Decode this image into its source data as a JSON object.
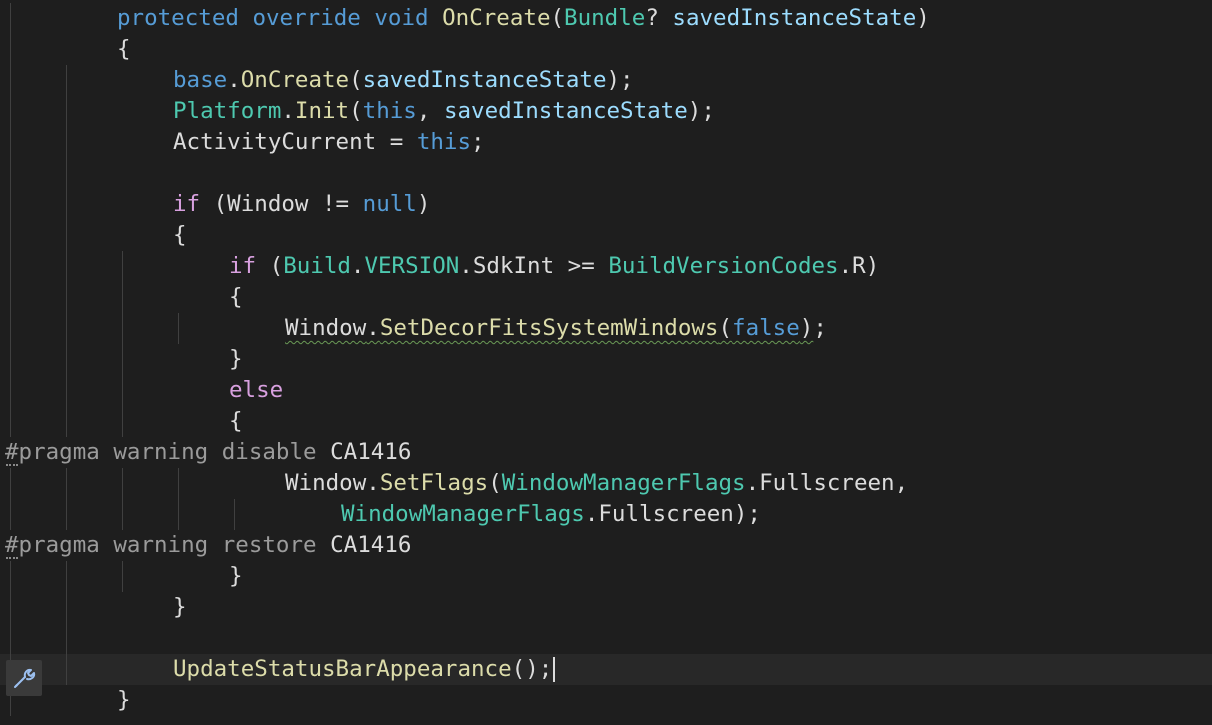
{
  "editor": {
    "lines": [
      {
        "indent": 2,
        "tokens": [
          {
            "text": "protected",
            "cls": "k"
          },
          {
            "text": " "
          },
          {
            "text": "override",
            "cls": "k"
          },
          {
            "text": " "
          },
          {
            "text": "void",
            "cls": "k"
          },
          {
            "text": " "
          },
          {
            "text": "OnCreate",
            "cls": "m"
          },
          {
            "text": "("
          },
          {
            "text": "Bundle",
            "cls": "t"
          },
          {
            "text": "? "
          },
          {
            "text": "savedInstanceState",
            "cls": "p"
          },
          {
            "text": ")"
          }
        ]
      },
      {
        "indent": 2,
        "tokens": [
          {
            "text": "{"
          }
        ]
      },
      {
        "indent": 3,
        "tokens": [
          {
            "text": "base",
            "cls": "k"
          },
          {
            "text": "."
          },
          {
            "text": "OnCreate",
            "cls": "m"
          },
          {
            "text": "("
          },
          {
            "text": "savedInstanceState",
            "cls": "p"
          },
          {
            "text": ");"
          }
        ]
      },
      {
        "indent": 3,
        "tokens": [
          {
            "text": "Platform",
            "cls": "t"
          },
          {
            "text": "."
          },
          {
            "text": "Init",
            "cls": "m"
          },
          {
            "text": "("
          },
          {
            "text": "this",
            "cls": "k"
          },
          {
            "text": ", "
          },
          {
            "text": "savedInstanceState",
            "cls": "p"
          },
          {
            "text": ");"
          }
        ]
      },
      {
        "indent": 3,
        "tokens": [
          {
            "text": "ActivityCurrent"
          },
          {
            "text": " = "
          },
          {
            "text": "this",
            "cls": "k"
          },
          {
            "text": ";"
          }
        ]
      },
      {
        "indent": 3,
        "tokens": []
      },
      {
        "indent": 3,
        "tokens": [
          {
            "text": "if",
            "cls": "c"
          },
          {
            "text": " (Window != "
          },
          {
            "text": "null",
            "cls": "k"
          },
          {
            "text": ")"
          }
        ]
      },
      {
        "indent": 3,
        "tokens": [
          {
            "text": "{"
          }
        ]
      },
      {
        "indent": 4,
        "tokens": [
          {
            "text": "if",
            "cls": "c"
          },
          {
            "text": " ("
          },
          {
            "text": "Build",
            "cls": "t"
          },
          {
            "text": "."
          },
          {
            "text": "VERSION",
            "cls": "t"
          },
          {
            "text": ".SdkInt >= "
          },
          {
            "text": "BuildVersionCodes",
            "cls": "t"
          },
          {
            "text": ".R)"
          }
        ]
      },
      {
        "indent": 4,
        "tokens": [
          {
            "text": "{"
          }
        ]
      },
      {
        "indent": 5,
        "tokens": [
          {
            "text": "Window",
            "cls": "squig"
          },
          {
            "text": ".",
            "cls": "squig"
          },
          {
            "text": "SetDecorFitsSystemWindows",
            "cls": "m squig"
          },
          {
            "text": "(",
            "cls": "squig"
          },
          {
            "text": "false",
            "cls": "k squig"
          },
          {
            "text": ")",
            "cls": "squig"
          },
          {
            "text": ";"
          }
        ]
      },
      {
        "indent": 4,
        "tokens": [
          {
            "text": "}"
          }
        ]
      },
      {
        "indent": 4,
        "tokens": [
          {
            "text": "else",
            "cls": "c"
          }
        ]
      },
      {
        "indent": 4,
        "tokens": [
          {
            "text": "{"
          }
        ]
      },
      {
        "indent": 0,
        "pragma": true,
        "tokens": [
          {
            "text": "#pragma warning disable",
            "cls": "pre"
          },
          {
            "text": " CA1416"
          }
        ]
      },
      {
        "indent": 5,
        "tokens": [
          {
            "text": "Window"
          },
          {
            "text": "."
          },
          {
            "text": "SetFlags",
            "cls": "m"
          },
          {
            "text": "("
          },
          {
            "text": "WindowManagerFlags",
            "cls": "t"
          },
          {
            "text": ".Fullscreen,"
          }
        ]
      },
      {
        "indent": 6,
        "tokens": [
          {
            "text": "WindowManagerFlags",
            "cls": "t"
          },
          {
            "text": ".Fullscreen);"
          }
        ]
      },
      {
        "indent": 0,
        "pragma": true,
        "tokens": [
          {
            "text": "#pragma warning restore",
            "cls": "pre"
          },
          {
            "text": " CA1416"
          }
        ]
      },
      {
        "indent": 4,
        "tokens": [
          {
            "text": "}"
          }
        ]
      },
      {
        "indent": 3,
        "tokens": [
          {
            "text": "}"
          }
        ]
      },
      {
        "indent": 3,
        "tokens": []
      },
      {
        "indent": 3,
        "current": true,
        "caret": true,
        "tokens": [
          {
            "text": "UpdateStatusBarAppearance",
            "cls": "m"
          },
          {
            "text": "();"
          }
        ]
      },
      {
        "indent": 2,
        "tokens": [
          {
            "text": "}"
          }
        ]
      }
    ]
  },
  "gutter": {
    "quick_action_icon": "wrench-screwdriver-icon"
  }
}
